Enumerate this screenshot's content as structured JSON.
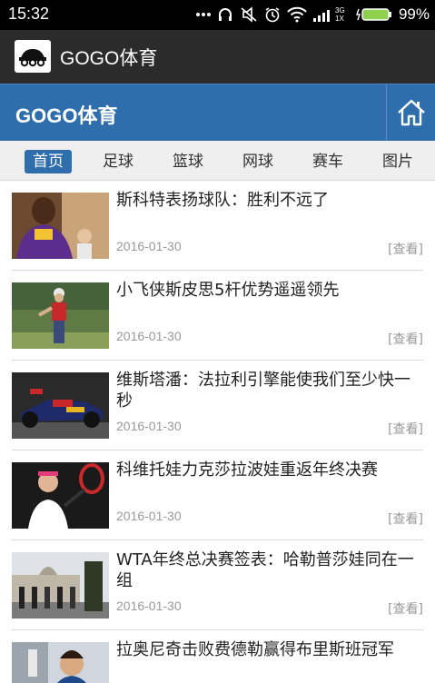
{
  "status_bar": {
    "time": "15:32",
    "network_label": "3G",
    "network_sub": "1X",
    "battery_percent": "99%",
    "icons": [
      "dots-icon",
      "headset-icon",
      "mute-icon",
      "alarm-icon",
      "wifi-icon",
      "signal-icon",
      "battery-icon"
    ]
  },
  "app_bar": {
    "title": "GOGO体育"
  },
  "header": {
    "title": "GOGO体育"
  },
  "tabs": [
    {
      "label": "首页",
      "active": true
    },
    {
      "label": "足球",
      "active": false
    },
    {
      "label": "篮球",
      "active": false
    },
    {
      "label": "网球",
      "active": false
    },
    {
      "label": "赛车",
      "active": false
    },
    {
      "label": "图片",
      "active": false
    }
  ],
  "news": [
    {
      "title": "斯科特表扬球队：胜利不远了",
      "date": "2016-01-30",
      "action": "[查看]"
    },
    {
      "title": "小飞侠斯皮思5杆优势遥遥领先",
      "date": "2016-01-30",
      "action": "[查看]"
    },
    {
      "title": "维斯塔潘：法拉利引擎能使我们至少快一秒",
      "date": "2016-01-30",
      "action": "[查看]"
    },
    {
      "title": "科维托娃力克莎拉波娃重返年终决赛",
      "date": "2016-01-30",
      "action": "[查看]"
    },
    {
      "title": "WTA年终总决赛签表：哈勒普莎娃同在一组",
      "date": "2016-01-30",
      "action": "[查看]"
    },
    {
      "title": "拉奥尼奇击败费德勒赢得布里斯班冠军",
      "date": "",
      "action": ""
    }
  ],
  "colors": {
    "accent": "#2f6ead",
    "app_bar": "#2b2b2b",
    "tab_bg": "#efefef"
  }
}
